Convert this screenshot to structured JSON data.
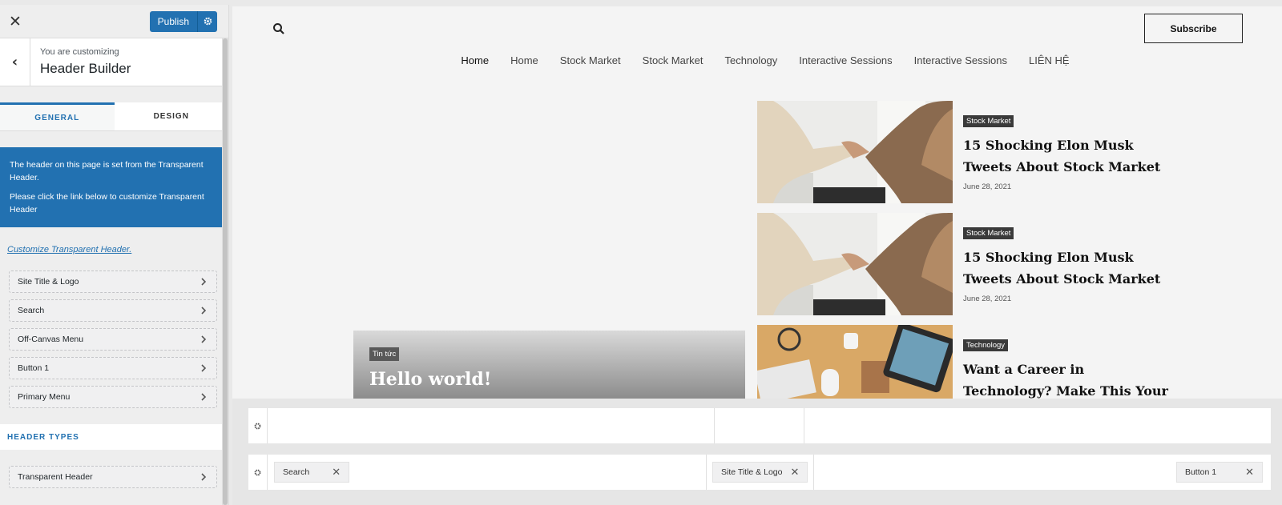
{
  "sidebar": {
    "close_label": "✕",
    "publish_label": "Publish",
    "back_label": "‹",
    "customizing_label": "You are customizing",
    "section_title": "Header Builder",
    "tabs": [
      {
        "label": "GENERAL"
      },
      {
        "label": "DESIGN"
      }
    ],
    "notice_line1": "The header on this page is set from the Transparent Header.",
    "notice_line2": "Please click the link below to customize Transparent Header",
    "customize_link": "Customize Transparent Header.",
    "items": [
      {
        "label": "Site Title & Logo"
      },
      {
        "label": "Search"
      },
      {
        "label": "Off-Canvas Menu"
      },
      {
        "label": "Button 1"
      },
      {
        "label": "Primary Menu"
      }
    ],
    "header_types_title": "HEADER TYPES",
    "header_types": [
      {
        "label": "Transparent Header"
      }
    ]
  },
  "preview": {
    "subscribe_label": "Subscribe",
    "nav": [
      {
        "label": "Home"
      },
      {
        "label": "Home"
      },
      {
        "label": "Stock Market"
      },
      {
        "label": "Stock Market"
      },
      {
        "label": "Technology"
      },
      {
        "label": "Interactive Sessions"
      },
      {
        "label": "Interactive Sessions"
      },
      {
        "label": "LIÊN HỆ"
      }
    ],
    "hero": {
      "category": "Tin tức",
      "title": "Hello world!"
    },
    "posts": [
      {
        "category": "Stock Market",
        "title": "15 Shocking Elon Musk Tweets About Stock Market",
        "date": "June 28, 2021",
        "image": "handshake-photo"
      },
      {
        "category": "Stock Market",
        "title": "15 Shocking Elon Musk Tweets About Stock Market",
        "date": "June 28, 2021",
        "image": "handshake-photo"
      },
      {
        "category": "Technology",
        "title": "Want a Career in Technology? Make This Your",
        "date": "",
        "image": "desk-workspace-photo"
      }
    ]
  },
  "builder": {
    "rows": [
      {
        "chips": []
      },
      {
        "chips": [
          {
            "label": "Search"
          },
          {
            "label": "Site Title & Logo"
          },
          {
            "label": "Button 1"
          }
        ]
      }
    ]
  },
  "colors": {
    "accent": "#2271b1",
    "tag_dark": "#3a3a3a"
  }
}
